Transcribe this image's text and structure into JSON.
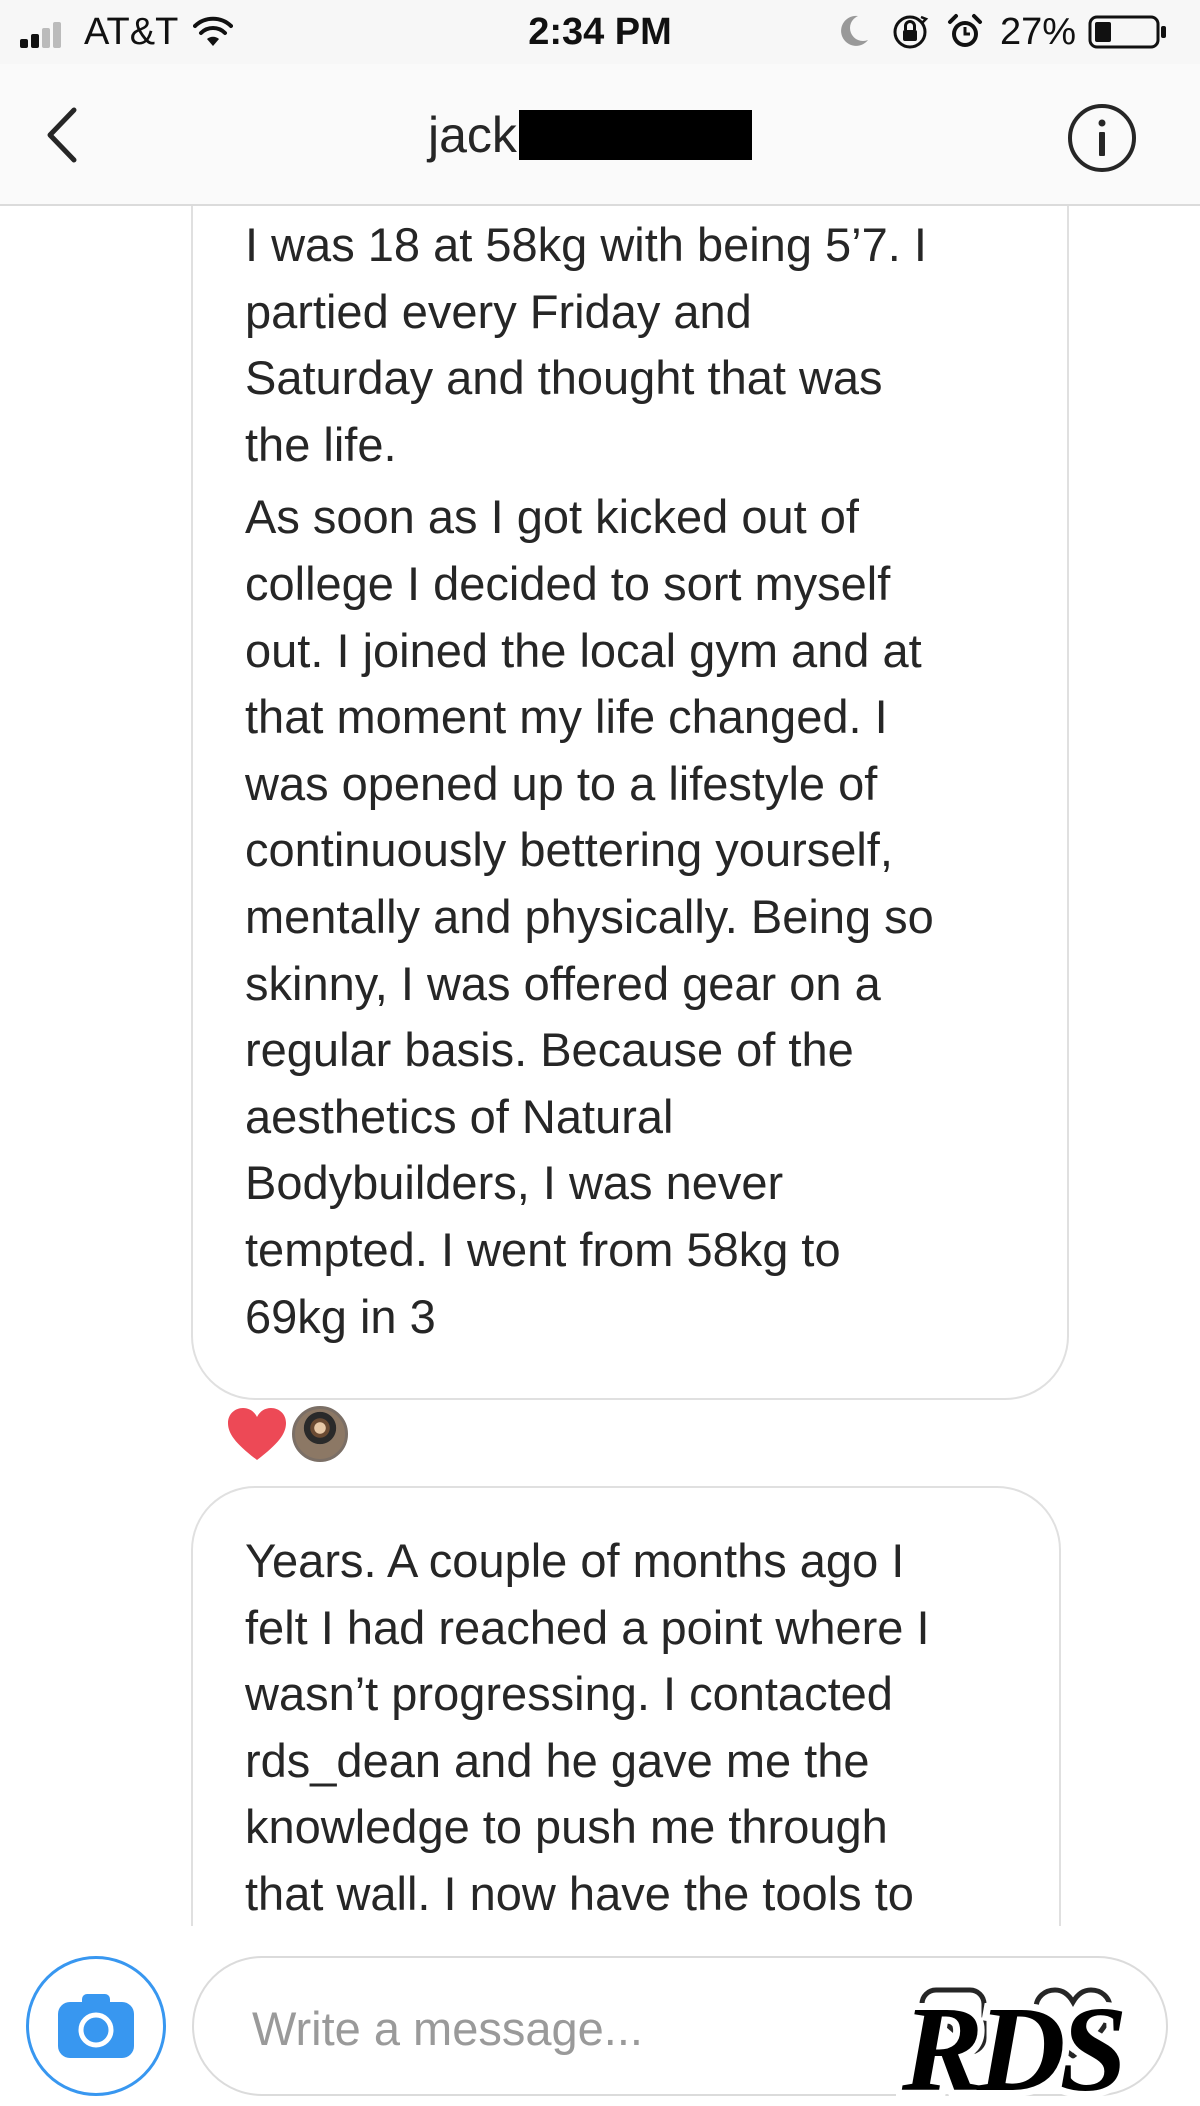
{
  "status_bar": {
    "carrier": "AT&T",
    "time": "2:34 PM",
    "battery_percent": "27%",
    "battery_level": 0.27,
    "signal_bars": 2,
    "icons": [
      "signal-icon",
      "wifi-icon",
      "moon-icon",
      "orientation-lock-icon",
      "alarm-icon",
      "battery-icon"
    ]
  },
  "header": {
    "title": "jack",
    "title_redacted": true,
    "icons": [
      "back-arrow-icon",
      "info-icon"
    ]
  },
  "messages": [
    {
      "paragraphs": [
        "I was 18 at 58kg with being 5’7. I\npartied every Friday and\nSaturday and thought that was\nthe life.",
        "As soon as I got kicked out of\ncollege I decided to sort myself\nout. I joined the local gym and at\nthat moment my life changed. I\nwas opened up to a lifestyle of\ncontinuously bettering yourself,\nmentally and physically. Being so\nskinny, I was offered gear on a\nregular basis. Because of the\naesthetics of Natural\nBodybuilders, I was never\ntempted. I went from 58kg to\n69kg in 3"
      ],
      "reactions": [
        "heart-icon",
        "reactor-avatar"
      ]
    },
    {
      "paragraphs": [
        "Years. A couple of months ago I\nfelt I had reached a point where I\nwasn’t progressing. I contacted\nrds_dean and he gave me the\nknowledge to push me through\nthat wall. I now have the tools to"
      ]
    }
  ],
  "composer": {
    "placeholder": "Write a message...",
    "icons": [
      "camera-icon",
      "gallery-icon",
      "like-heart-icon"
    ]
  },
  "watermark": {
    "text": "RDS"
  },
  "colors": {
    "accent_blue": "#3897f0",
    "heart_red": "#ed4956",
    "bubble_border": "#e0e0e0",
    "text": "#262626"
  }
}
